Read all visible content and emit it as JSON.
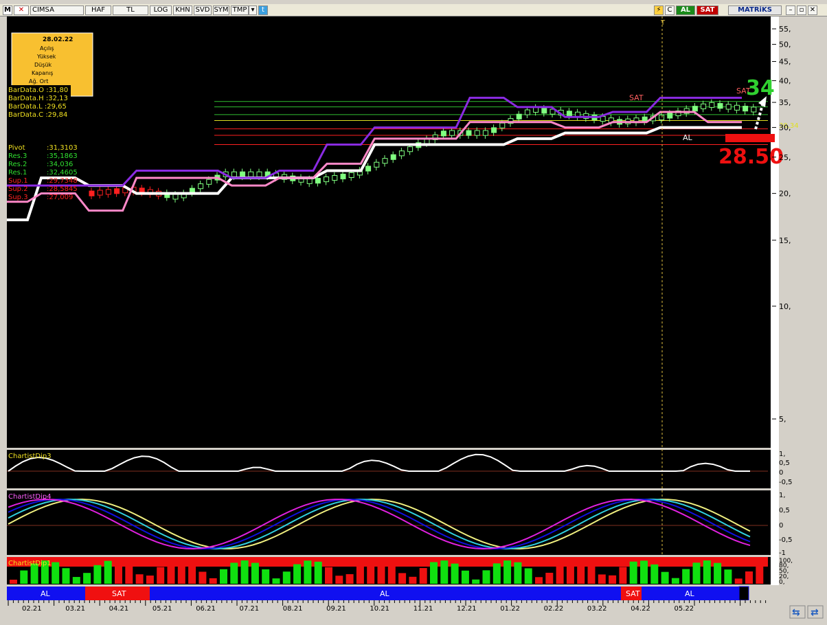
{
  "toolbar": {
    "app_icon": "M",
    "symbol": "CIMSA",
    "buttons": [
      "HAF",
      "TL",
      "LOG",
      "KHN",
      "SVD",
      "SYM",
      "TMP"
    ],
    "al_label": "AL",
    "sat_label": "SAT",
    "brand": "MATRiKS"
  },
  "info_box": {
    "date": "28.02.22",
    "rows": [
      "Açılış",
      "Yüksek",
      "Düşük",
      "Kapanış",
      "Ağ. Ort"
    ]
  },
  "bar_data": [
    "BarData.O :31,80",
    "BarData.H :32,13",
    "BarData.L :29,65",
    "BarData.C :29,84"
  ],
  "pivots": [
    {
      "label": "Pivot",
      "value": ":31,3103",
      "color": "#f0e020"
    },
    {
      "label": "Res.3",
      "value": ":35,1863",
      "color": "#30e030"
    },
    {
      "label": "Res.2",
      "value": ":34,036",
      "color": "#30e030"
    },
    {
      "label": "Res.1",
      "value": ":32,4605",
      "color": "#30e030"
    },
    {
      "label": "Sup.1",
      "value": ":29,7348",
      "color": "#ff2020"
    },
    {
      "label": "Sup.2",
      "value": ":28,5845",
      "color": "#ff2020"
    },
    {
      "label": "Sup.3",
      "value": ":27,009",
      "color": "#ff2020"
    }
  ],
  "annotations": {
    "target_high": "34",
    "target_low": "28.50",
    "last_price": "30,34",
    "sat_marker_1": "SAT",
    "sat_marker_2": "SAT",
    "al_marker": "AL",
    "vertical_marker": "T"
  },
  "price_axis": [
    "55,",
    "50,",
    "45,",
    "40,",
    "35,",
    "30,",
    "25,",
    "20,",
    "15,",
    "10,",
    "5,"
  ],
  "panels": {
    "dip3": {
      "title": "ChartistDip3",
      "ticks": [
        "1,",
        "0,5",
        "0",
        "-0,5"
      ]
    },
    "dip4": {
      "title": "ChartistDip4",
      "ticks": [
        "1,",
        "0,5",
        "0",
        "-0,5",
        "-1"
      ]
    },
    "dip1": {
      "title": "ChartistDip1",
      "ticks": [
        "100,",
        "80,",
        "50,",
        "20,",
        "0,"
      ]
    }
  },
  "signal_bar": [
    {
      "label": "AL",
      "color": "#1010f0"
    },
    {
      "label": "SAT",
      "color": "#f01010"
    },
    {
      "label": "AL",
      "color": "#1010f0"
    },
    {
      "label": "SAT",
      "color": "#f01010"
    },
    {
      "label": "AL",
      "color": "#1010f0"
    }
  ],
  "date_axis": [
    "02.21",
    "03.21",
    "04.21",
    "05.21",
    "06.21",
    "07.21",
    "08.21",
    "09.21",
    "10.21",
    "11.21",
    "12.21",
    "01.22",
    "02.22",
    "03.22",
    "04.22",
    "05.22"
  ],
  "chart_data": {
    "type": "line",
    "title": "",
    "ylabel": "",
    "ylim": [
      3,
      57
    ],
    "y_scale": "log",
    "x": [
      "02.21",
      "03.21",
      "04.21",
      "05.21",
      "06.21",
      "07.21",
      "08.21",
      "09.21",
      "10.21",
      "11.21",
      "12.21",
      "01.22",
      "02.22",
      "03.22",
      "04.22",
      "05.22"
    ],
    "series": [
      {
        "color": "#ffffff",
        "values": [
          17,
          22,
          21,
          20,
          20,
          22,
          22,
          23,
          27,
          27,
          27,
          28,
          29,
          29,
          30,
          30
        ]
      },
      {
        "color": "#8a2be2",
        "values": [
          21,
          21,
          21,
          23,
          23,
          22,
          23,
          27,
          30,
          30,
          36,
          34,
          32,
          33,
          36,
          36
        ]
      },
      {
        "color": "#ff88c8",
        "values": [
          19,
          20,
          18,
          22,
          22,
          21,
          22,
          24,
          28,
          28,
          31,
          31,
          30,
          31,
          33,
          31
        ]
      }
    ],
    "horizontal_levels": [
      35.1863,
      34.036,
      32.4605,
      31.3103,
      29.7348,
      28.5845,
      27.009
    ],
    "legend": "none",
    "grid": false
  },
  "colors": {
    "background": "#000000",
    "buy": "#30e030",
    "sell": "#ff2020",
    "info_box": "#f8c030"
  }
}
